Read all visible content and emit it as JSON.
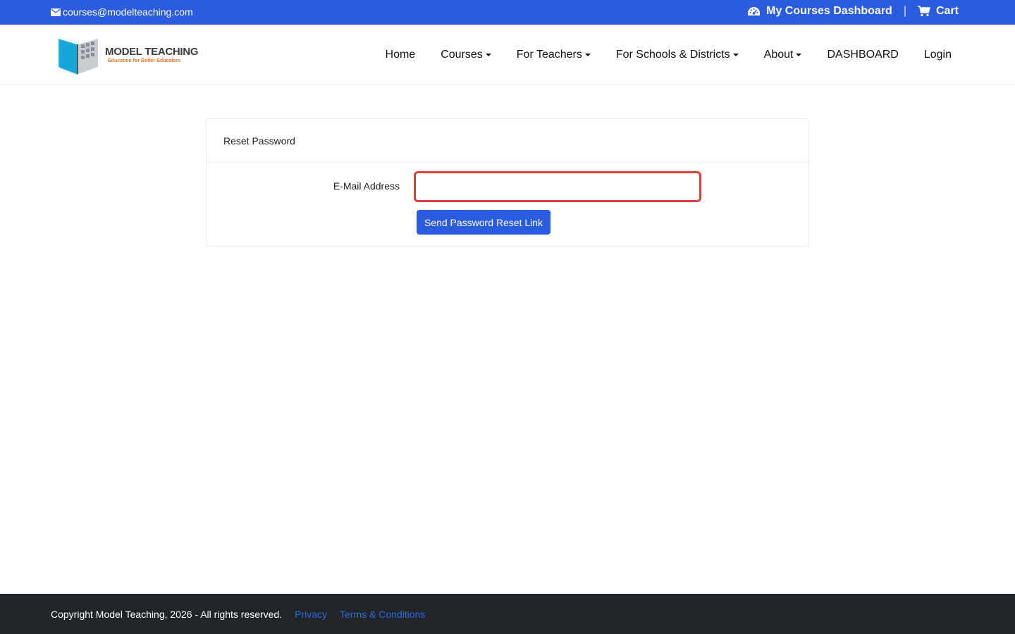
{
  "topbar": {
    "email": "courses@modelteaching.com",
    "dashboard_label": "My Courses Dashboard",
    "separator": "|",
    "cart_label": "Cart",
    "color": "#2b5ce0"
  },
  "logo": {
    "brand": "MODEL TEACHING",
    "tagline": "Education for Better Educators"
  },
  "nav": {
    "home": "Home",
    "courses": "Courses",
    "teachers": "For Teachers",
    "schools": "For Schools & Districts",
    "about": "About",
    "dashboard": "DASHBOARD",
    "login": "Login"
  },
  "card": {
    "title": "Reset Password",
    "email_label": "E-Mail Address",
    "email_value": "",
    "button_label": "Send Password Reset Link"
  },
  "footer": {
    "copyright": "Copyright Model Teaching, 2026 - All rights reserved.",
    "privacy": "Privacy",
    "terms": "Terms & Conditions"
  }
}
